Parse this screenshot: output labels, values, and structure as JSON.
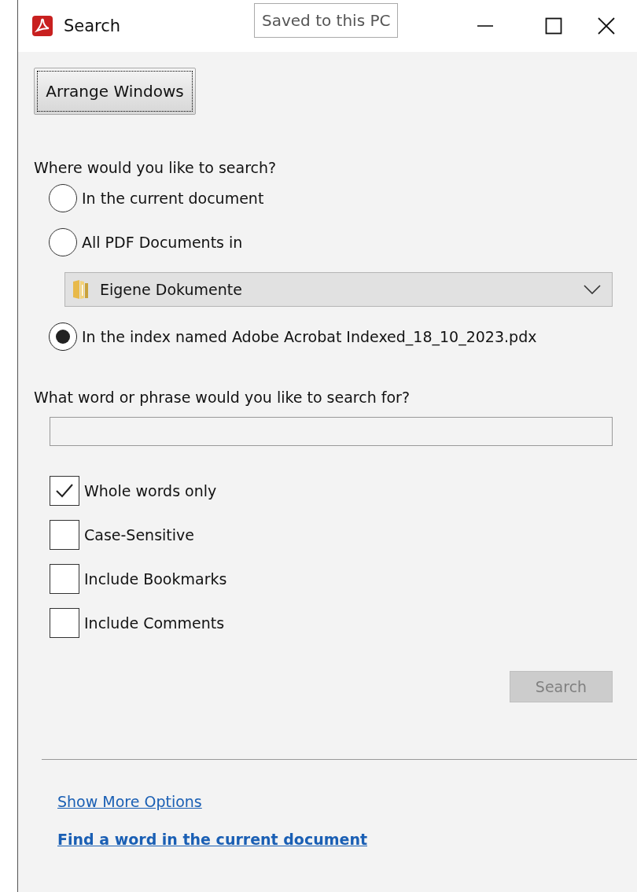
{
  "window": {
    "title": "Search"
  },
  "tooltip": "Saved to this PC",
  "arrange_button": {
    "label": "Arrange Windows",
    "focused": true
  },
  "scope": {
    "label": "Where would you like to search?",
    "options": [
      {
        "label": "In the current document",
        "selected": false
      },
      {
        "label": "All PDF Documents in",
        "selected": false,
        "folder": "Eigene Dokumente"
      },
      {
        "label": "In the index named Adobe Acrobat Indexed_18_10_2023.pdx",
        "selected": true
      }
    ]
  },
  "query": {
    "label": "What word or phrase would you like to search for?"
  },
  "options": [
    {
      "label": "Whole words only",
      "checked": true
    },
    {
      "label": "Case-Sensitive",
      "checked": false
    },
    {
      "label": "Include Bookmarks",
      "checked": false
    },
    {
      "label": "Include Comments",
      "checked": false
    }
  ],
  "search_button": {
    "label": "Search",
    "disabled": true
  },
  "links": [
    {
      "label": "Show More Options",
      "bold": false
    },
    {
      "label": "Find a word in the current document",
      "bold": true
    }
  ]
}
